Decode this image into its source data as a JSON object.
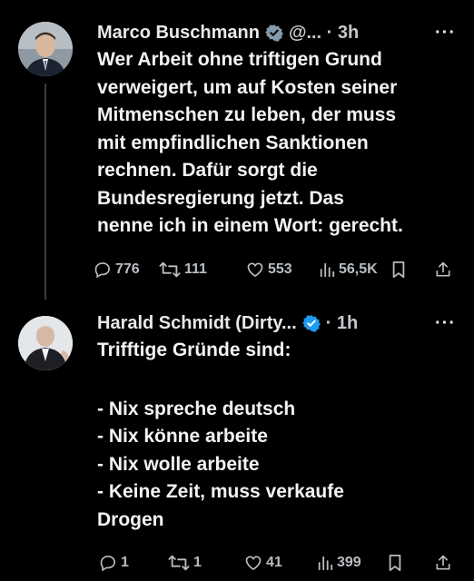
{
  "tweets": [
    {
      "author_name": "Marco Buschmann",
      "meta": "@... · 3h",
      "more": "···",
      "lines": [
        "Wer Arbeit ohne triftigen Grund",
        "verweigert, um auf Kosten seiner",
        "Mitmenschen zu leben, der muss",
        "mit empfindlichen Sanktionen",
        "rechnen. Dafür sorgt die",
        "Bundesregierung jetzt. Das",
        "nenne ich in einem Wort: gerecht."
      ],
      "replies": "776",
      "reposts": "111",
      "likes": "553",
      "views": "56,5K"
    },
    {
      "author_name": "Harald Schmidt (Dirty...",
      "meta": "· 1h",
      "more": "···",
      "lines": [
        "Trifftige Gründe sind:",
        "",
        "- Nix spreche deutsch",
        "- Nix könne arbeite",
        "- Nix wolle arbeite",
        "- Keine Zeit, muss verkaufe",
        "Drogen"
      ],
      "replies": "1",
      "reposts": "1",
      "likes": "41",
      "views": "399"
    }
  ],
  "colors": {
    "background": "#000000",
    "text": "#e7e9ea",
    "secondary": "#b8bdc2",
    "verified_badge_t1": "#829aab",
    "verified_badge_t2": "#1d9bf0"
  }
}
